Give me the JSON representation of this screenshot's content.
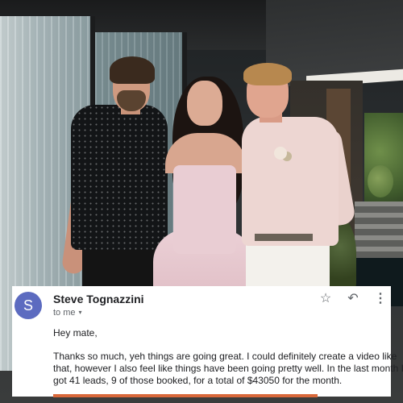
{
  "email": {
    "avatar_letter": "S",
    "sender_name": "Steve Tognazzini",
    "recipient_label": "to me",
    "recipient_caret": "▾",
    "actions": {
      "star_icon": "☆",
      "reply_icon": "↶",
      "more_icon": "⋮"
    },
    "greeting": "Hey mate,",
    "body_lines": [
      "Thanks so much, yeh things are going great. I could definitely create a video like",
      "that, however I also feel like things have been going pretty well. In the last month I've",
      "got 41 leads, 9 of those booked, for a total of $43050 for the month."
    ]
  },
  "colors": {
    "avatar_bg": "#5c6bc0",
    "highlight": "#d9683a"
  }
}
